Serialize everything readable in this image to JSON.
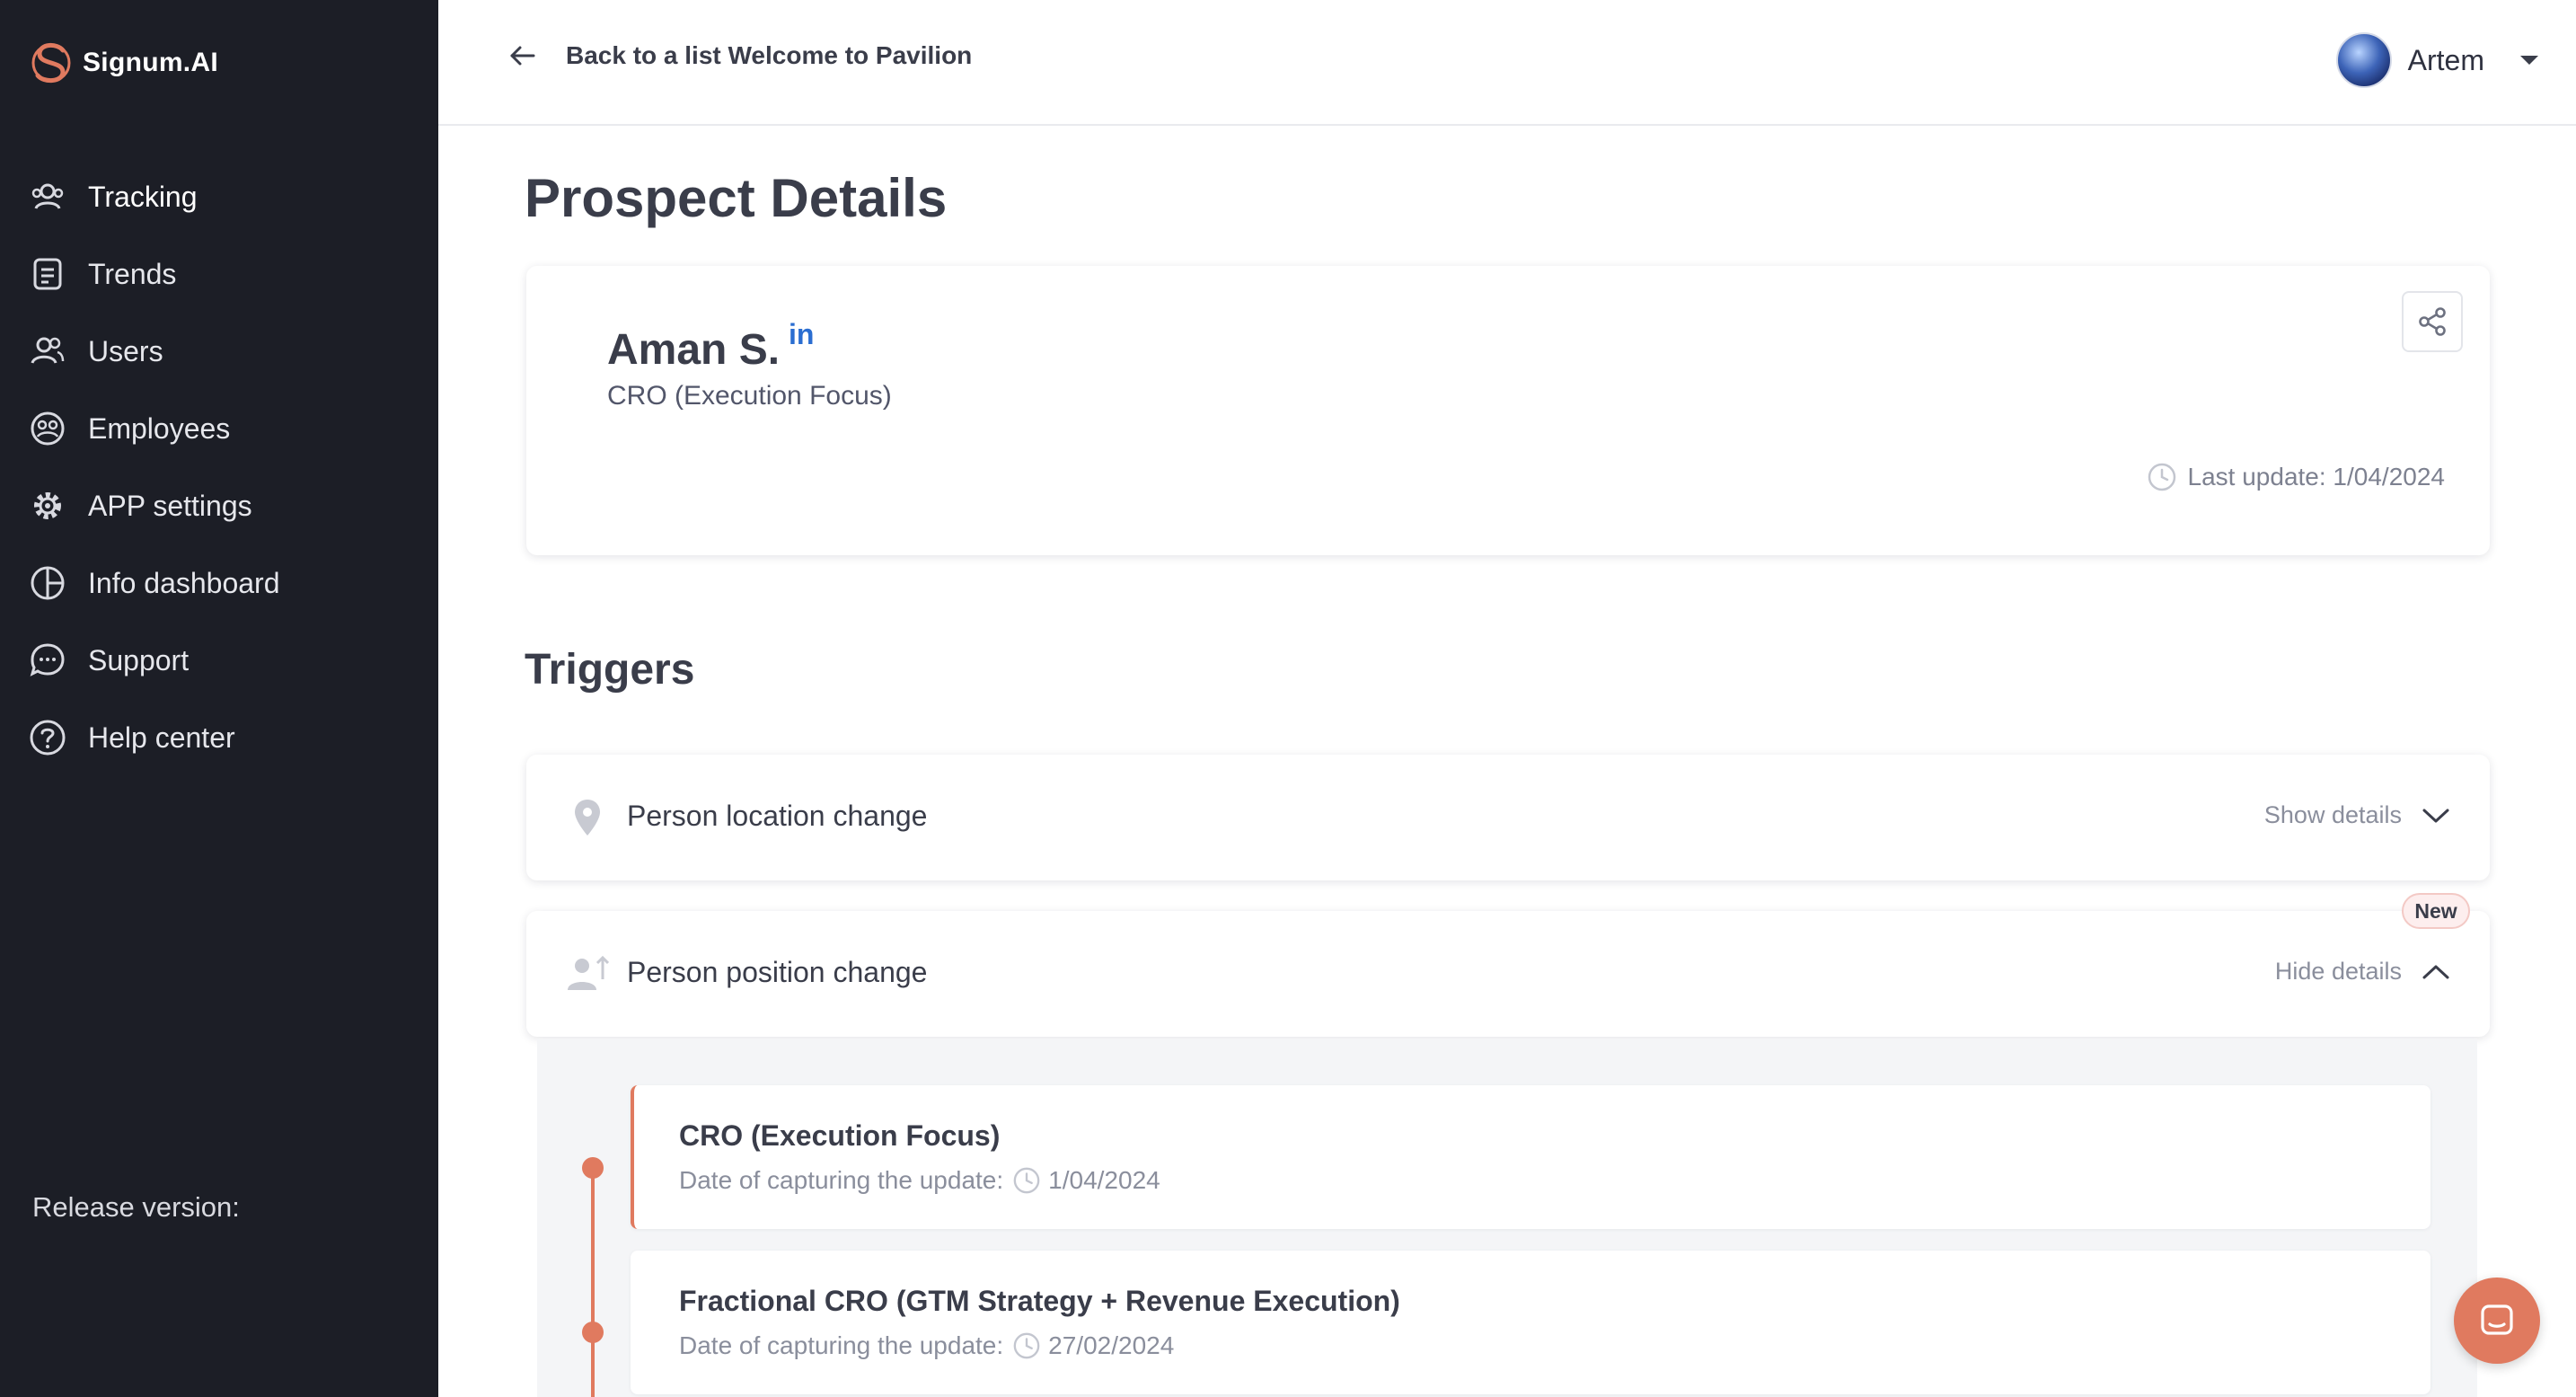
{
  "brand": {
    "name": "Signum.AI"
  },
  "sidebar": {
    "items": [
      {
        "label": "Tracking",
        "icon": "users-tracking-icon"
      },
      {
        "label": "Trends",
        "icon": "document-icon"
      },
      {
        "label": "Users",
        "icon": "users-icon"
      },
      {
        "label": "Employees",
        "icon": "employees-icon"
      },
      {
        "label": "APP settings",
        "icon": "gear-icon"
      },
      {
        "label": "Info dashboard",
        "icon": "pie-chart-icon"
      },
      {
        "label": "Support",
        "icon": "chat-bubble-icon"
      },
      {
        "label": "Help center",
        "icon": "help-circle-icon"
      }
    ],
    "release_label": "Release version:"
  },
  "header": {
    "back_label": "Back to a list Welcome to Pavilion",
    "user_name": "Artem"
  },
  "page": {
    "title": "Prospect Details"
  },
  "prospect": {
    "name": "Aman S.",
    "linkedin_label": "in",
    "role": "CRO (Execution Focus)",
    "last_update": "Last update: 1/04/2024"
  },
  "triggers": {
    "title": "Triggers",
    "items": [
      {
        "label": "Person location change",
        "toggle_label": "Show details",
        "icon": "location-pin-icon"
      },
      {
        "label": "Person position change",
        "toggle_label": "Hide details",
        "badge": "New",
        "icon": "person-up-icon"
      }
    ],
    "history": [
      {
        "title": "CRO (Execution Focus)",
        "meta_label": "Date of capturing the update:",
        "date": "1/04/2024"
      },
      {
        "title": "Fractional CRO (GTM Strategy + Revenue Execution)",
        "meta_label": "Date of capturing the update:",
        "date": "27/02/2024"
      }
    ]
  },
  "colors": {
    "sidebar_bg": "#1c1e26",
    "accent": "#e07a5f",
    "linkedin": "#2b6ed1"
  }
}
